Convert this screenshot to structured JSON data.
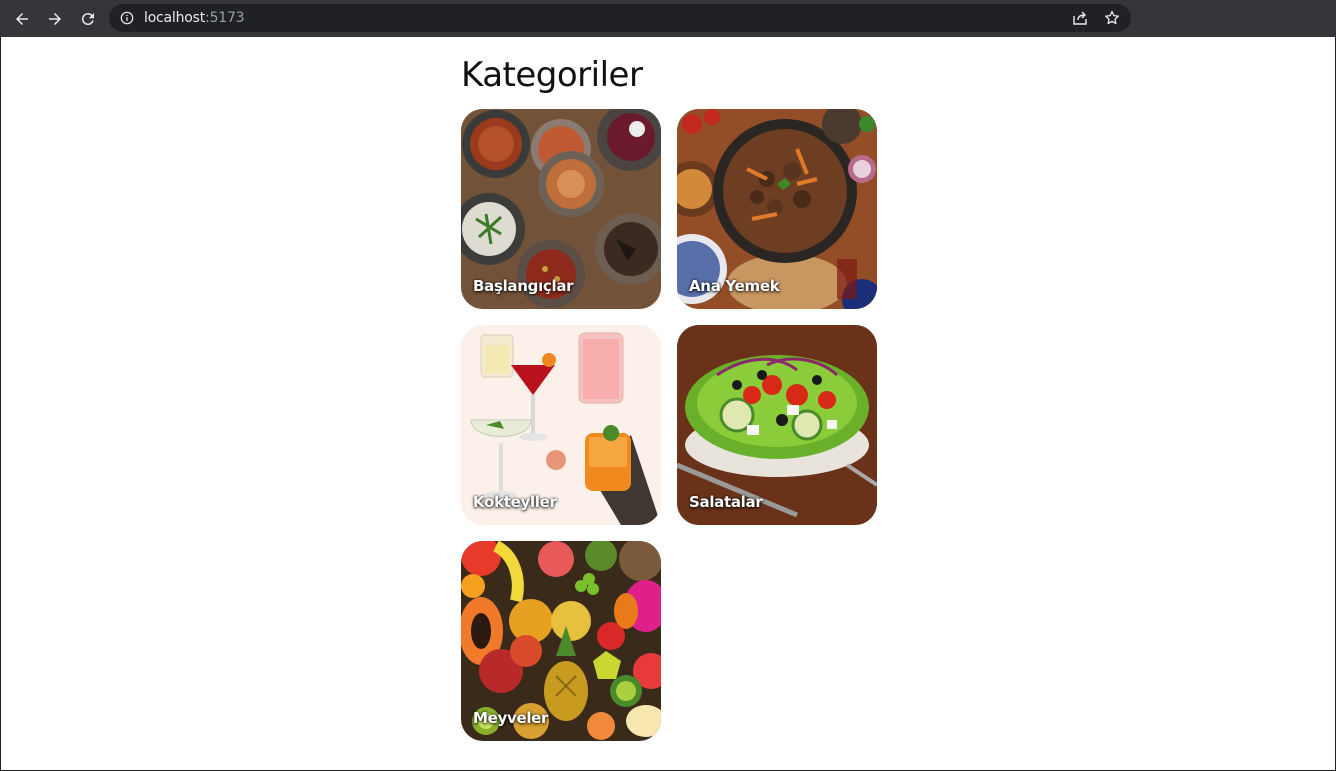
{
  "browser": {
    "url_host": "localhost",
    "url_port": ":5173"
  },
  "page": {
    "title": "Kategoriler"
  },
  "categories": [
    {
      "label": "Başlangıçlar",
      "icon": "appetizers-image"
    },
    {
      "label": "Ana Yemek",
      "icon": "main-course-image"
    },
    {
      "label": "Kokteyller",
      "icon": "cocktails-image"
    },
    {
      "label": "Salatalar",
      "icon": "salads-image"
    },
    {
      "label": "Meyveler",
      "icon": "fruits-image"
    }
  ]
}
